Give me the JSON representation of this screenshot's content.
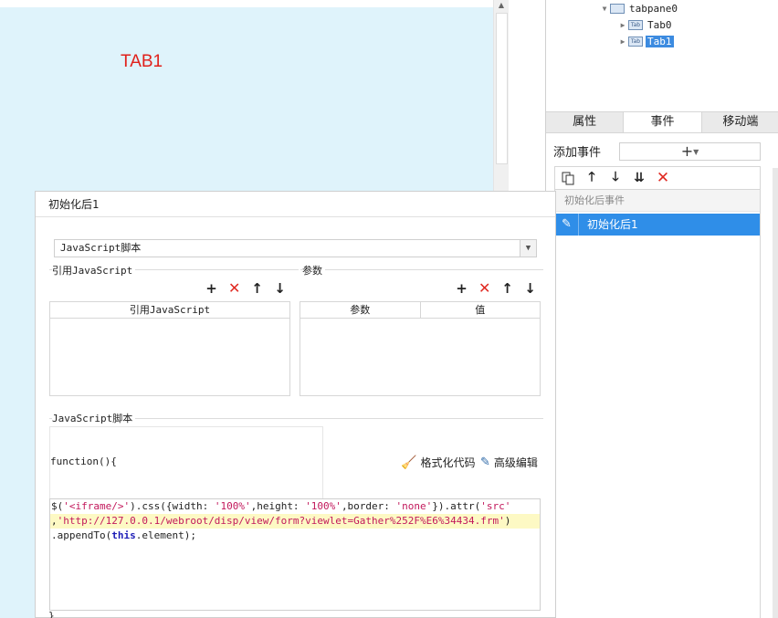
{
  "canvas": {
    "tab_title": "TAB1",
    "tab_color": "#e0211b",
    "bg_color": "#dff3fb"
  },
  "tree": {
    "nodes": [
      {
        "label": "tabpane0",
        "level": 0,
        "expanded": true,
        "selected": false
      },
      {
        "label": "Tab0",
        "level": 1,
        "expanded": false,
        "selected": false
      },
      {
        "label": "Tab1",
        "level": 1,
        "expanded": false,
        "selected": true
      }
    ],
    "node_icon_text": "Tab"
  },
  "panel_tabs": [
    "属性",
    "事件",
    "移动端"
  ],
  "events": {
    "add_label": "添加事件",
    "add_button": "+",
    "group": "初始化后事件",
    "items": [
      "初始化后1"
    ]
  },
  "dialog": {
    "title": "初始化后1",
    "language": "JavaScript脚本",
    "ref_js_section": "引用JavaScript",
    "ref_js_column": "引用JavaScript",
    "params_section": "参数",
    "params_columns": [
      "参数",
      "值"
    ],
    "script_section": "JavaScript脚本",
    "function_head": "function(){",
    "format_code": "格式化代码",
    "advanced_edit": "高级编辑",
    "function_close": "}",
    "code_lines": [
      {
        "highlight": false,
        "parts": [
          {
            "t": "$(",
            "c": ""
          },
          {
            "t": "'<iframe/>'",
            "c": "str"
          },
          {
            "t": ").css({width: ",
            "c": ""
          },
          {
            "t": "'100%'",
            "c": "str"
          },
          {
            "t": ",height: ",
            "c": ""
          },
          {
            "t": "'100%'",
            "c": "str"
          },
          {
            "t": ",border: ",
            "c": ""
          },
          {
            "t": "'none'",
            "c": "str"
          },
          {
            "t": "}).attr(",
            "c": ""
          },
          {
            "t": "'src'",
            "c": "str"
          }
        ]
      },
      {
        "highlight": true,
        "parts": [
          {
            "t": ",",
            "c": ""
          },
          {
            "t": "'http://127.0.0.1/webroot/disp/view/form?viewlet=Gather%252F%E6%34434.frm'",
            "c": "str"
          },
          {
            "t": ")",
            "c": ""
          }
        ]
      },
      {
        "highlight": false,
        "parts": [
          {
            "t": ".appendTo(",
            "c": ""
          },
          {
            "t": "this",
            "c": "kw"
          },
          {
            "t": ".element);",
            "c": ""
          }
        ]
      }
    ]
  },
  "icons": {
    "copy": "copy-icon",
    "up": "arrow-up-icon",
    "down": "arrow-down-icon",
    "bottom": "move-bottom-icon",
    "delete": "delete-icon",
    "add": "plus-icon",
    "broom": "broom-icon",
    "edit": "edit-icon",
    "pen": "pencil-icon"
  }
}
